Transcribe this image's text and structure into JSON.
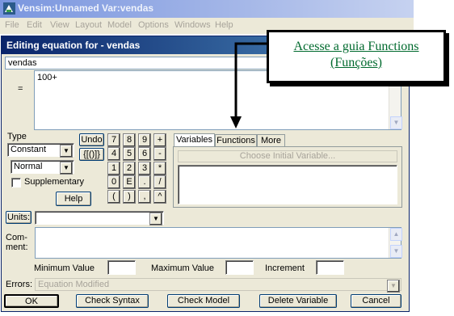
{
  "window": {
    "title": "Vensim:Unnamed Var:vendas",
    "menu": [
      "File",
      "Edit",
      "View",
      "Layout",
      "Model",
      "Options",
      "Windows",
      "Help"
    ]
  },
  "dialog": {
    "title": "Editing equation for - vendas",
    "variable_name": "vendas",
    "equals": "=",
    "equation": "100+",
    "type_label": "Type",
    "type_value": "Constant",
    "subtype_value": "Normal",
    "supplementary_label": "Supplementary",
    "help_label": "Help",
    "undo_label": "Undo",
    "brackets_label": "{[()]}",
    "keypad": [
      "7",
      "8",
      "9",
      "+",
      "4",
      "5",
      "6",
      "-",
      "1",
      "2",
      "3",
      "*",
      "0",
      "E",
      ".",
      "/",
      "(",
      ")",
      ",",
      "^"
    ],
    "units_label": "Units:",
    "units_value": "",
    "comment_label_1": "Com-",
    "comment_label_2": "ment:",
    "min_label": "Minimum Value",
    "max_label": "Maximum Value",
    "increment_label": "Increment",
    "errors_label": "Errors:",
    "errors_value": "Equation Modified",
    "tabs": [
      "Variables",
      "Functions",
      "More"
    ],
    "choose_initial_label": "Choose Initial Variable...",
    "buttons": {
      "ok": "OK",
      "check_syntax": "Check Syntax",
      "check_model": "Check Model",
      "delete_variable": "Delete Variable",
      "cancel": "Cancel"
    }
  },
  "callout": {
    "line1": "Acesse a guia Functions",
    "line2": "(Funções)",
    "color": "#006a2e"
  }
}
